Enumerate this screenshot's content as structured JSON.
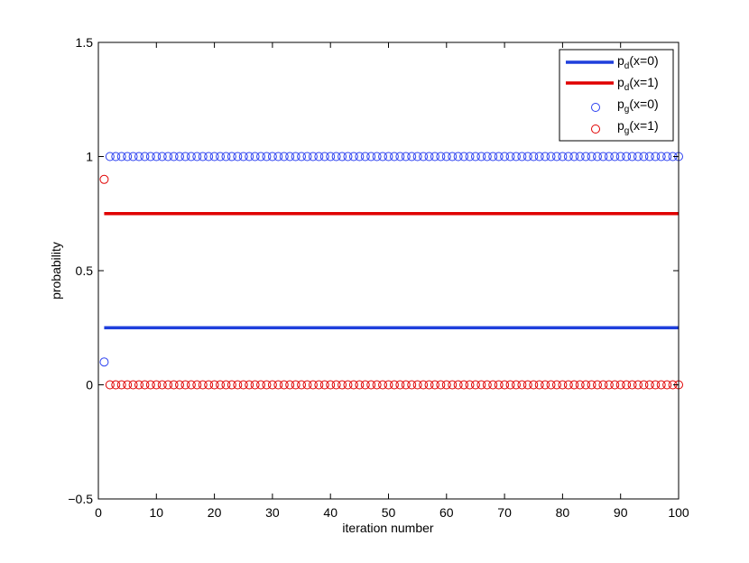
{
  "chart_data": {
    "type": "line",
    "title": "",
    "xlabel": "iteration number",
    "ylabel": "probability",
    "xlim": [
      0,
      100
    ],
    "ylim": [
      -0.5,
      1.5
    ],
    "xticks": [
      0,
      10,
      20,
      30,
      40,
      50,
      60,
      70,
      80,
      90,
      100
    ],
    "yticks": [
      -0.5,
      0,
      0.5,
      1,
      1.5
    ],
    "xtick_labels": [
      "0",
      "10",
      "20",
      "30",
      "40",
      "50",
      "60",
      "70",
      "80",
      "90",
      "100"
    ],
    "ytick_labels": [
      "−0.5",
      "0",
      "0.5",
      "1",
      "1.5"
    ],
    "grid": false,
    "legend_position": "top-right",
    "series": [
      {
        "name_base": "p",
        "name_sub": "d",
        "name_rest": "(x=0)",
        "kind": "line",
        "color": "#1f3fdc",
        "x": [
          1,
          100
        ],
        "y": [
          0.25,
          0.25
        ]
      },
      {
        "name_base": "p",
        "name_sub": "d",
        "name_rest": "(x=1)",
        "kind": "line",
        "color": "#e00000",
        "x": [
          1,
          100
        ],
        "y": [
          0.75,
          0.75
        ]
      },
      {
        "name_base": "p",
        "name_sub": "g",
        "name_rest": "(x=0)",
        "kind": "scatter",
        "color": "#2a3ff0",
        "x_range": [
          1,
          100
        ],
        "y_first": 0.1,
        "y_rest": 1.0
      },
      {
        "name_base": "p",
        "name_sub": "g",
        "name_rest": "(x=1)",
        "kind": "scatter",
        "color": "#e00000",
        "x_range": [
          1,
          100
        ],
        "y_first": 0.9,
        "y_rest": 0.0
      }
    ]
  }
}
